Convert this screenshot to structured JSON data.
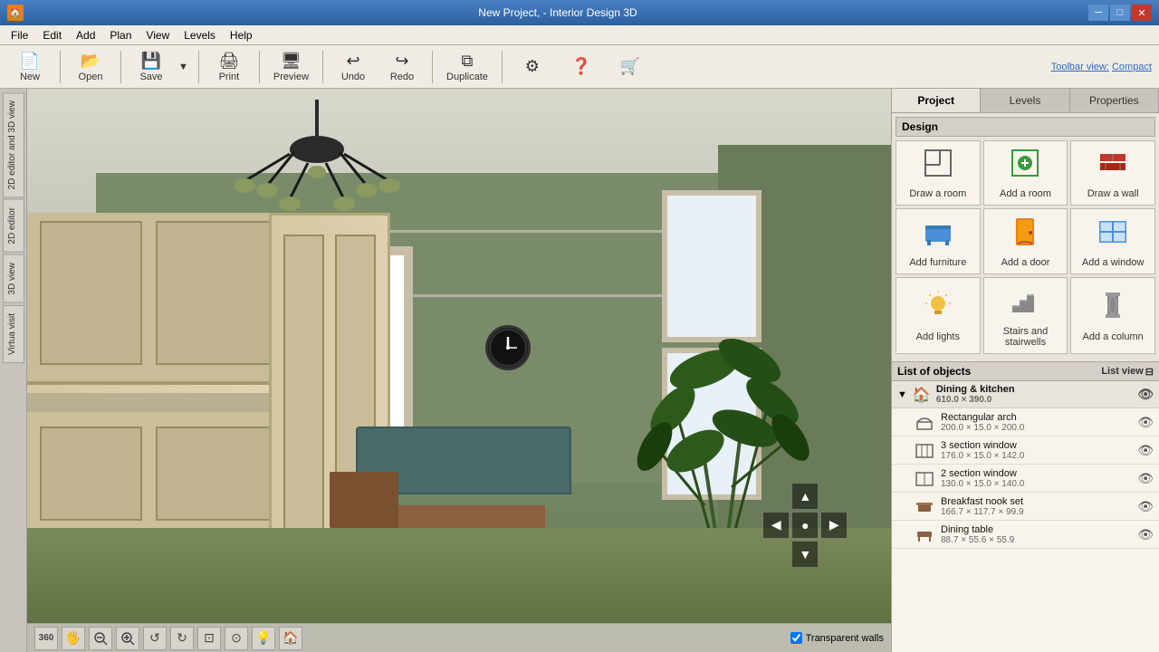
{
  "titlebar": {
    "title": "New Project, - Interior Design 3D",
    "app_icon": "🏠",
    "controls": [
      "─",
      "□",
      "✕"
    ]
  },
  "menu": {
    "items": [
      "File",
      "Edit",
      "Add",
      "Plan",
      "View",
      "Levels",
      "Help"
    ]
  },
  "toolbar": {
    "new_label": "New",
    "open_label": "Open",
    "save_label": "Save",
    "print_label": "Print",
    "preview_label": "Preview",
    "undo_label": "Undo",
    "redo_label": "Redo",
    "duplicate_label": "Duplicate",
    "toolbar_view_label": "Toolbar view:",
    "compact_label": "Compact"
  },
  "left_tabs": {
    "items": [
      "2D editor and 3D view",
      "2D editor",
      "3D view",
      "Virtua visit"
    ]
  },
  "right_panel": {
    "tabs": [
      "Project",
      "Levels",
      "Properties"
    ],
    "active_tab": 0,
    "design_section_label": "Design",
    "design_buttons": [
      {
        "id": "draw-room",
        "label": "Draw a room",
        "icon": "room"
      },
      {
        "id": "add-room",
        "label": "Add a room",
        "icon": "addroom"
      },
      {
        "id": "draw-wall",
        "label": "Draw a wall",
        "icon": "wall"
      },
      {
        "id": "add-furniture",
        "label": "Add furniture",
        "icon": "furniture"
      },
      {
        "id": "add-door",
        "label": "Add a door",
        "icon": "door"
      },
      {
        "id": "add-window",
        "label": "Add a window",
        "icon": "window"
      },
      {
        "id": "add-lights",
        "label": "Add lights",
        "icon": "lights"
      },
      {
        "id": "stairs",
        "label": "Stairs and stairwells",
        "icon": "stairs"
      },
      {
        "id": "add-column",
        "label": "Add a column",
        "icon": "column"
      }
    ],
    "list_label": "List of objects",
    "list_view_label": "List view",
    "objects": [
      {
        "id": "dining-kitchen",
        "name": "Dining & kitchen",
        "dims": "610.0 × 390.0",
        "is_group": true,
        "items": [
          {
            "id": "rectangular-arch",
            "name": "Rectangular arch",
            "dims": "200.0 × 15.0 × 200.0"
          },
          {
            "id": "3-section-window",
            "name": "3 section window",
            "dims": "176.0 × 15.0 × 142.0"
          },
          {
            "id": "2-section-window",
            "name": "2 section window",
            "dims": "130.0 × 15.0 × 140.0"
          },
          {
            "id": "breakfast-nook",
            "name": "Breakfast nook set",
            "dims": "166.7 × 117.7 × 99.9"
          },
          {
            "id": "dining-table",
            "name": "Dining table",
            "dims": "88.7 × 55.6 × 55.9"
          }
        ]
      }
    ]
  },
  "bottom_toolbar": {
    "tools": [
      "360",
      "🖐",
      "🔍-",
      "🔍+",
      "↺",
      "↻",
      "⊡",
      "⊙",
      "💡",
      "🏠"
    ],
    "transparent_walls": "Transparent walls"
  }
}
